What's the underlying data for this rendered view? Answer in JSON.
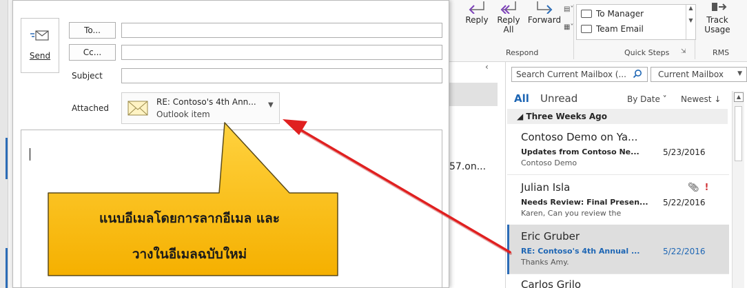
{
  "ribbon": {
    "respond": {
      "reply": "Reply",
      "reply_all_1": "Reply",
      "reply_all_2": "All",
      "forward": "Forward",
      "label": "Respond"
    },
    "quick_steps": {
      "to_manager": "To Manager",
      "team_email": "Team Email",
      "label": "Quick Steps"
    },
    "rms": {
      "track_1": "Track",
      "track_2": "Usage",
      "label": "RMS"
    }
  },
  "reading_pane": {
    "partial_text": "57.on..."
  },
  "search": {
    "placeholder": "Search Current Mailbox (...",
    "scope": "Current Mailbox"
  },
  "filters": {
    "all": "All",
    "unread": "Unread",
    "sort_by": "By Date ˅",
    "order": "Newest ↓"
  },
  "group": {
    "header": "◢ Three Weeks Ago"
  },
  "messages": [
    {
      "from": "Contoso Demo on Ya...",
      "subject": "Updates from Contoso Ne...",
      "date": "5/23/2016",
      "preview": "Contoso Demo"
    },
    {
      "from": "Julian Isla",
      "subject": "Needs Review: Final Presen...",
      "date": "5/22/2016",
      "preview": "Karen,  Can you review the"
    },
    {
      "from": "Eric Gruber",
      "subject": "RE: Contoso's 4th Annual ...",
      "date": "5/22/2016",
      "preview": "Thanks Amy."
    },
    {
      "from": "Carlos Grilo",
      "subject": "",
      "date": "",
      "preview": ""
    }
  ],
  "compose": {
    "send": "Send",
    "to": "To...",
    "cc": "Cc...",
    "subject_label": "Subject",
    "attached_label": "Attached",
    "attachment": {
      "title": "RE: Contoso's 4th Ann...",
      "type": "Outlook item"
    }
  },
  "callout": {
    "line1": "แนบอีเมลโดยการลากอีเมล และ",
    "line2": "วางในอีเมลฉบับใหม่"
  },
  "colors": {
    "accent": "#2b6cb7",
    "callout_fill": "#ffc000",
    "arrow": "#e02020",
    "important": "#d13438"
  }
}
